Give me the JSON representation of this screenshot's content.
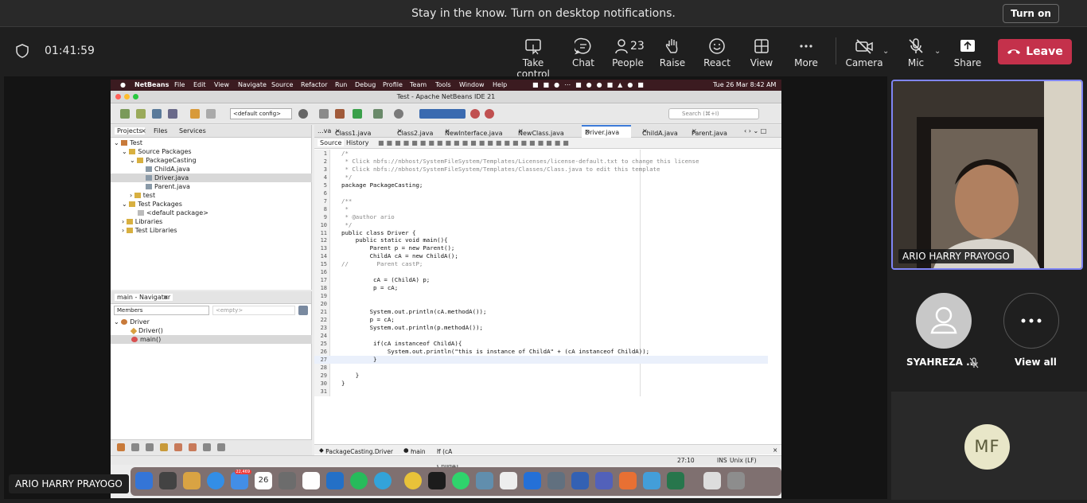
{
  "notification": {
    "text": "Stay in the know. Turn on desktop notifications.",
    "button": "Turn on"
  },
  "meeting": {
    "timer": "01:41:59"
  },
  "toolbar": {
    "take_control": "Take control",
    "chat": "Chat",
    "people": "People",
    "people_count": "23",
    "raise": "Raise",
    "react": "React",
    "view": "View",
    "more": "More",
    "camera": "Camera",
    "mic": "Mic",
    "share": "Share",
    "leave": "Leave"
  },
  "mac": {
    "menu": [
      "NetBeans",
      "File",
      "Edit",
      "View",
      "Navigate",
      "Source",
      "Refactor",
      "Run",
      "Debug",
      "Profile",
      "Team",
      "Tools",
      "Window",
      "Help"
    ],
    "clock": "Tue 26 Mar  8:42 AM"
  },
  "netbeans": {
    "title": "Test - Apache NetBeans IDE 21",
    "config": "<default config>",
    "search_placeholder": "Search (⌘+I)",
    "panel_tabs": [
      "Projects",
      "Files",
      "Services"
    ],
    "tree": [
      "Test",
      "Source Packages",
      "PackageCasting",
      "ChildA.java",
      "Driver.java",
      "Parent.java",
      "test",
      "Test Packages",
      "<default package>",
      "Libraries",
      "Test Libraries"
    ],
    "navigator": {
      "title": "main - Navigator",
      "members": "Members",
      "empty": "<empty>",
      "items": [
        "Driver",
        "Driver()",
        "main()"
      ]
    },
    "editor_tabs": [
      "...va",
      "Class1.java",
      "Class2.java",
      "NewInterface.java",
      "NewClass.java",
      "Driver.java",
      "ChildA.java",
      "Parent.java"
    ],
    "source_tab": "Source",
    "history_tab": "History",
    "code_lines": [
      "/*",
      " * Click nbfs://nbhost/SystemFileSystem/Templates/Licenses/license-default.txt to change this license",
      " * Click nbfs://nbhost/SystemFileSystem/Templates/Classes/Class.java to edit this template",
      " */",
      "package PackageCasting;",
      "",
      "/**",
      " *",
      " * @author ario",
      " */",
      "public class Driver {",
      "    public static void main(){",
      "        Parent p = new Parent();",
      "        ChildA cA = new ChildA();",
      "//        Parent castP;",
      "",
      "         cA = (ChildA) p;",
      "         p = cA;",
      "",
      "",
      "        System.out.println(cA.methodA());",
      "        p = cA;",
      "        System.out.println(p.methodA());",
      "",
      "         if(cA instanceof ChildA){",
      "             System.out.println(\"this is instance of ChildA\" + (cA instanceof ChildA));",
      "         }",
      "",
      "    }",
      "}",
      ""
    ],
    "breadcrumb": [
      "PackageCasting.Driver",
      "main",
      "if (cA instanceof ChildA)"
    ],
    "cursor": "27:10",
    "ins": "INS",
    "eol": "Unix (LF)"
  },
  "dock": {
    "mail_badge": "22,469",
    "calendar_day": "26"
  },
  "presenter_label": "ARIO HARRY PRAYOGO",
  "participants": {
    "video_name": "ARIO HARRY PRAYOGO",
    "p2_name": "SYAHREZA ...",
    "view_all": "View all",
    "mf_initials": "MF"
  },
  "colors": {
    "leave": "#c4314b",
    "active_tile": "#7f85f5",
    "mf_avatar": "#e8e6c8"
  }
}
